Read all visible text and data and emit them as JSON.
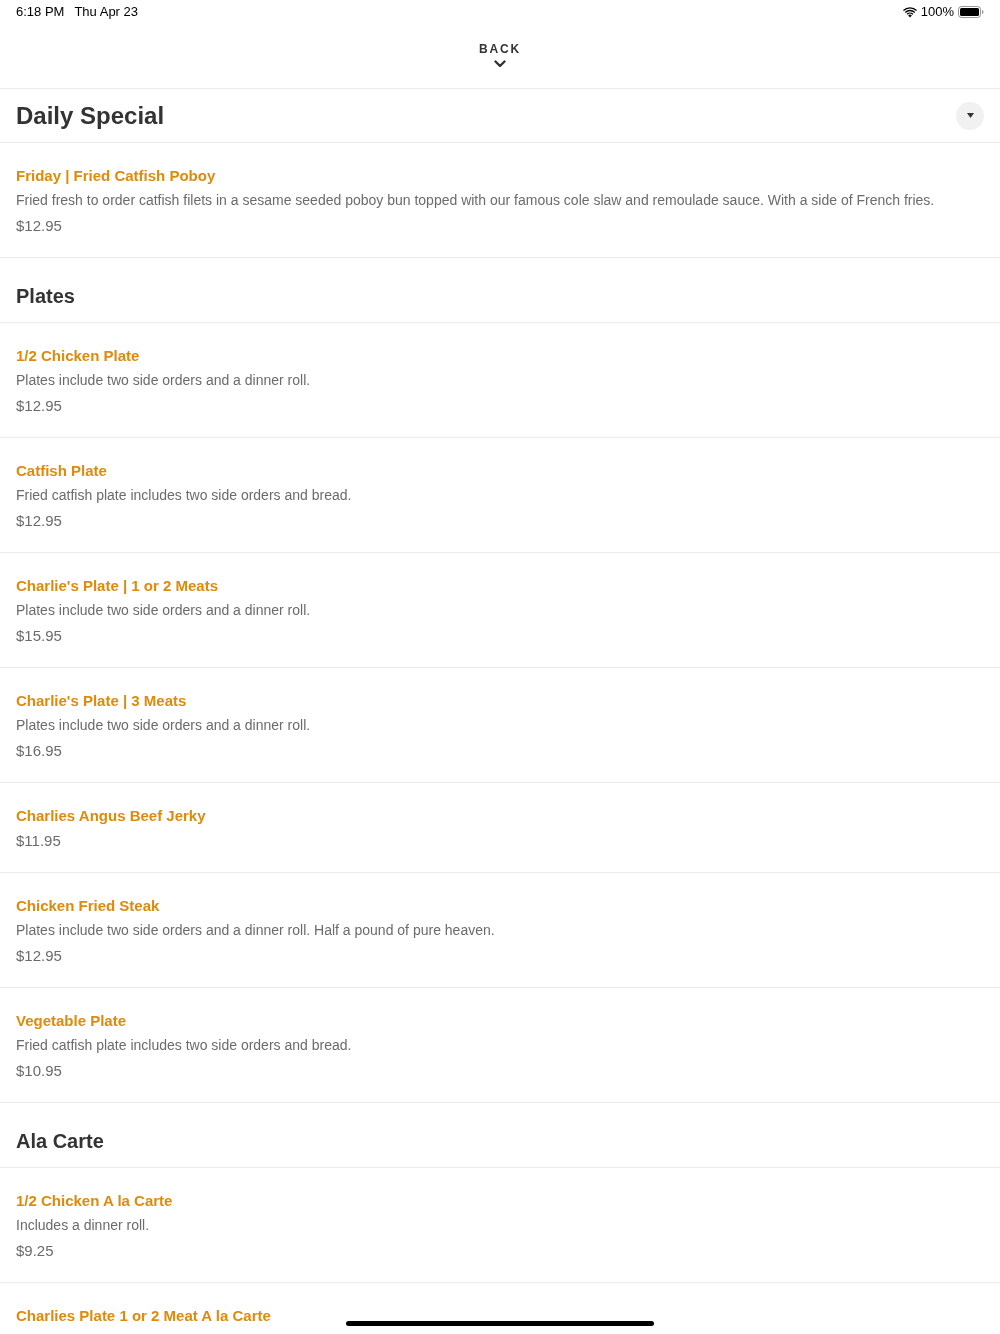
{
  "status_bar": {
    "time": "6:18 PM",
    "date": "Thu Apr 23",
    "battery": "100%"
  },
  "back_button": {
    "label": "BACK"
  },
  "sections": [
    {
      "kind": "featured",
      "title": "Daily Special",
      "items": [
        {
          "name": "Friday | Fried Catfish Poboy",
          "description": "Fried fresh to order catfish filets in a sesame seeded poboy bun topped with our famous cole slaw and remoulade sauce. With a side of French fries.",
          "price": "$12.95"
        }
      ]
    },
    {
      "kind": "category",
      "title": "Plates",
      "items": [
        {
          "name": "1/2 Chicken Plate",
          "description": "Plates include two side orders and a dinner roll.",
          "price": "$12.95"
        },
        {
          "name": "Catfish Plate",
          "description": "Fried catfish plate includes two side orders and bread.",
          "price": "$12.95"
        },
        {
          "name": "Charlie's Plate | 1 or 2 Meats",
          "description": "Plates include two side orders and a dinner roll.",
          "price": "$15.95"
        },
        {
          "name": "Charlie's Plate | 3 Meats",
          "description": "Plates include two side orders and a dinner roll.",
          "price": "$16.95"
        },
        {
          "name": "Charlies Angus Beef Jerky",
          "price": "$11.95"
        },
        {
          "name": "Chicken Fried Steak",
          "description": "Plates include two side orders and a dinner roll. Half a pound of pure heaven.",
          "price": "$12.95"
        },
        {
          "name": "Vegetable Plate",
          "description": "Fried catfish plate includes two side orders and bread.",
          "price": "$10.95"
        }
      ]
    },
    {
      "kind": "category",
      "title": "Ala Carte",
      "items": [
        {
          "name": "1/2 Chicken A la Carte",
          "description": "Includes a dinner roll.",
          "price": "$9.25"
        },
        {
          "name": "Charlies Plate 1 or 2 Meat A la Carte"
        }
      ]
    }
  ]
}
